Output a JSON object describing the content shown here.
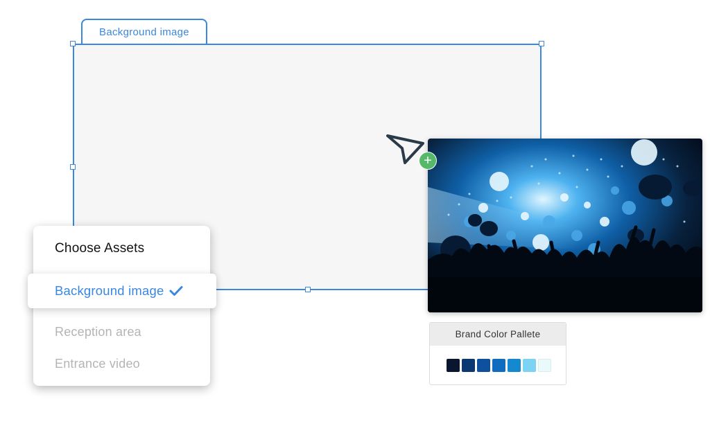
{
  "canvas": {
    "tab_label": "Background image",
    "accent_color": "#3a87e0"
  },
  "media": {
    "image_icon": "concert-crowd-image",
    "add_icon": "plus-icon",
    "add_symbol": "+"
  },
  "palette": {
    "title": "Brand Color Pallete",
    "colors": [
      "#0a1530",
      "#0b3872",
      "#0e4f9e",
      "#0f6cbe",
      "#1489cf",
      "#7dd3f3",
      "#eafafb"
    ]
  },
  "menu": {
    "title": "Choose Assets",
    "selected": "Background image",
    "items": [
      "Reception area",
      "Entrance video"
    ]
  }
}
